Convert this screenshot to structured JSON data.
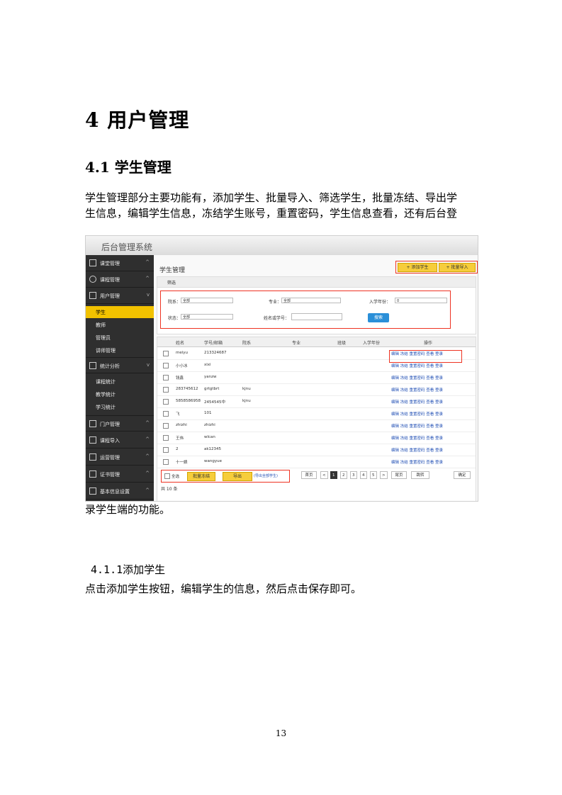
{
  "doc": {
    "h1": "4 用户管理",
    "h2": "4.1 学生管理",
    "para1_line1": "学生管理部分主要功能有，添加学生、批量导入、筛选学生，批量冻结、导出学",
    "para1_line2": "生信息，编辑学生信息，冻结学生账号，重置密码，学生信息查看，还有后台登",
    "para1_line3": "录学生端的功能。",
    "h3": "4.1.1添加学生",
    "para2": "点击添加学生按钮，编辑学生的信息，然后点击保存即可。",
    "page_number": "13"
  },
  "screenshot": {
    "app_title": "后台管理系统",
    "sidebar": {
      "sections": [
        {
          "label": "课堂管理",
          "chevron": "^"
        },
        {
          "label": "课程管理",
          "chevron": "^"
        },
        {
          "label": "用户管理",
          "chevron": "v"
        }
      ],
      "user_items": [
        "学生",
        "教师",
        "管理员",
        "讲师管理"
      ],
      "stats_section": {
        "label": "统计分析",
        "chevron": "v"
      },
      "stats_items": [
        "课程统计",
        "教学统计",
        "学习统计"
      ],
      "more_sections": [
        {
          "label": "门户管理",
          "chevron": "^"
        },
        {
          "label": "课程导入",
          "chevron": "^"
        },
        {
          "label": "运营管理",
          "chevron": "^"
        },
        {
          "label": "证书管理",
          "chevron": "^"
        },
        {
          "label": "基本信息设置",
          "chevron": "^"
        }
      ]
    },
    "page_title": "学生管理",
    "buttons": {
      "add": "+ 添加学生",
      "import": "+ 批量导入"
    },
    "filter": {
      "header": "筛选",
      "college_label": "院系：",
      "college_value": "全部",
      "major_label": "专业：",
      "major_value": "全部",
      "year_label": "入学年份：",
      "year_value": "0",
      "status_label": "状态：",
      "status_value": "全部",
      "keyword_label": "姓名或学号：",
      "keyword_value": "",
      "search_btn": "搜索"
    },
    "table": {
      "headers": [
        "姓名",
        "学号/邮箱",
        "院系",
        "专业",
        "班级",
        "入学年份",
        "操作"
      ],
      "rows": [
        {
          "name": "meiyu",
          "id": "213324687",
          "dept": ""
        },
        {
          "name": "小小冰",
          "id": "xixi",
          "dept": ""
        },
        {
          "name": "钱鑫",
          "id": "yanzw",
          "dept": ""
        },
        {
          "name": "283745612",
          "id": "grtgtbrt",
          "dept": "kjnu"
        },
        {
          "name": "5858586958",
          "id": "2454545中",
          "dept": "kjnu"
        },
        {
          "name": "飞",
          "id": "101",
          "dept": ""
        },
        {
          "name": "zhizhi",
          "id": "zhizhi",
          "dept": ""
        },
        {
          "name": "王伟",
          "id": "wlcan",
          "dept": ""
        },
        {
          "name": "2",
          "id": "ak12345",
          "dept": ""
        },
        {
          "name": "十一娘",
          "id": "wangyue",
          "dept": ""
        }
      ],
      "ops_text": "编辑  冻结  重置密码  查看  登录"
    },
    "footer": {
      "select_all": "全选",
      "batch_freeze": "批量冻结",
      "export": "导出",
      "export_note": "(导出全部学生)",
      "pages": [
        "首页",
        "<",
        "1",
        "2",
        "3",
        "4",
        "5",
        ">",
        "尾页"
      ],
      "jump": "跳转",
      "goto": "确定",
      "total": "共 10 条"
    }
  }
}
